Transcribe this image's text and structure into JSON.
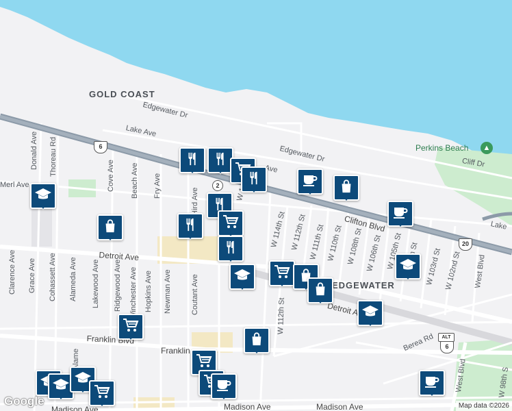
{
  "colors": {
    "water": "#8fd8f0",
    "land": "#f2f2f4",
    "road": "#ffffff",
    "highway": "#8c9aa8",
    "park": "#cdeccf",
    "urban": "#f3e8c4",
    "poi_pin": "#0d4a7a"
  },
  "labels": {
    "areas": [
      "GOLD COAST",
      "EDGEWATER"
    ],
    "park": "Perkins Beach",
    "streets": {
      "edgewater_dr_1": "Edgewater Dr",
      "edgewater_dr_2": "Edgewater Dr",
      "lake_ave_1": "Lake Ave",
      "lake_ave_2": "Lake Ave",
      "cliff_dr": "Cliff Dr",
      "clifton_blvd": "Clifton Blvd",
      "detroit_ave_1": "Detroit Ave",
      "detroit_ave_2": "Detroit Ave",
      "franklin_blvd_1": "Franklin Blvd",
      "franklin_blvd_2": "Franklin",
      "madison_ave_1": "Madison Ave",
      "madison_ave_2": "Madison Ave",
      "merl_ave": "Merl Ave",
      "berea_rd": "Berea Rd",
      "west_blvd_1": "West Blvd",
      "west_blvd_2": "West Blvd",
      "donald_ave": "Donald Ave",
      "thoreau_rd": "Thoreau Rd",
      "cove_ave": "Cove Ave",
      "beach_ave": "Beach Ave",
      "fry_ave": "Fry Ave",
      "hird_ave": "Hird Ave",
      "clarence_ave": "Clarence Ave",
      "grace_ave": "Grace Ave",
      "cohassett_ave": "Cohassett Ave",
      "alameda_ave": "Alameda Ave",
      "alame": "Alame",
      "lakewood_ave": "Lakewood Ave",
      "ridgewood_ave": "Ridgewood Ave",
      "winchester_ave": "Winchester Ave",
      "hopkins_ave": "Hopkins Ave",
      "newman_ave": "Newman Ave",
      "coutant_ave": "Coutant Ave",
      "w114": "W 114th St",
      "w112": "W 112th St",
      "w112_b": "W 112th St",
      "w111": "W 111th St",
      "w110": "W 110th St",
      "w108": "W 108th St",
      "w106": "W 106th St",
      "w105": "W 105th St",
      "w104": "h St",
      "w103": "W 103rd St",
      "w102": "W 102nd St",
      "w98": "W 98th S",
      "w1": "W 1",
      "ave_short": "Ave",
      "lake_short": "Lake"
    },
    "shields": {
      "us6_a": "6",
      "us6_b": "6",
      "us20": "20",
      "alt": "ALT",
      "oh2": "2"
    }
  },
  "pois": [
    {
      "type": "restaurant",
      "icon": "fork-knife-icon"
    },
    {
      "type": "restaurant",
      "icon": "fork-knife-icon"
    },
    {
      "type": "shopping",
      "icon": "cart-icon"
    },
    {
      "type": "restaurant",
      "icon": "fork-knife-icon"
    },
    {
      "type": "cafe",
      "icon": "cup-icon"
    },
    {
      "type": "store",
      "icon": "bag-icon"
    },
    {
      "type": "cafe",
      "icon": "cup-icon"
    },
    {
      "type": "school",
      "icon": "graduation-cap-icon"
    },
    {
      "type": "restaurant",
      "icon": "fork-knife-icon"
    },
    {
      "type": "shopping",
      "icon": "cart-icon"
    },
    {
      "type": "store",
      "icon": "bag-icon"
    },
    {
      "type": "restaurant",
      "icon": "fork-knife-icon"
    },
    {
      "type": "restaurant",
      "icon": "fork-knife-icon"
    },
    {
      "type": "school",
      "icon": "graduation-cap-icon"
    },
    {
      "type": "shopping",
      "icon": "cart-icon"
    },
    {
      "type": "store",
      "icon": "bag-icon"
    },
    {
      "type": "store",
      "icon": "bag-icon"
    },
    {
      "type": "school",
      "icon": "graduation-cap-icon"
    },
    {
      "type": "school",
      "icon": "graduation-cap-icon"
    },
    {
      "type": "shopping",
      "icon": "cart-icon"
    },
    {
      "type": "store",
      "icon": "bag-icon"
    },
    {
      "type": "shopping",
      "icon": "cart-icon"
    },
    {
      "type": "school",
      "icon": "graduation-cap-icon"
    },
    {
      "type": "school",
      "icon": "graduation-cap-icon"
    },
    {
      "type": "school",
      "icon": "graduation-cap-icon"
    },
    {
      "type": "shopping",
      "icon": "cart-icon"
    },
    {
      "type": "shopping",
      "icon": "cart-icon"
    },
    {
      "type": "cafe",
      "icon": "cup-icon"
    },
    {
      "type": "cafe",
      "icon": "cup-icon"
    }
  ],
  "attribution": {
    "logo": "Google",
    "map_data": "Map data ©2026"
  }
}
